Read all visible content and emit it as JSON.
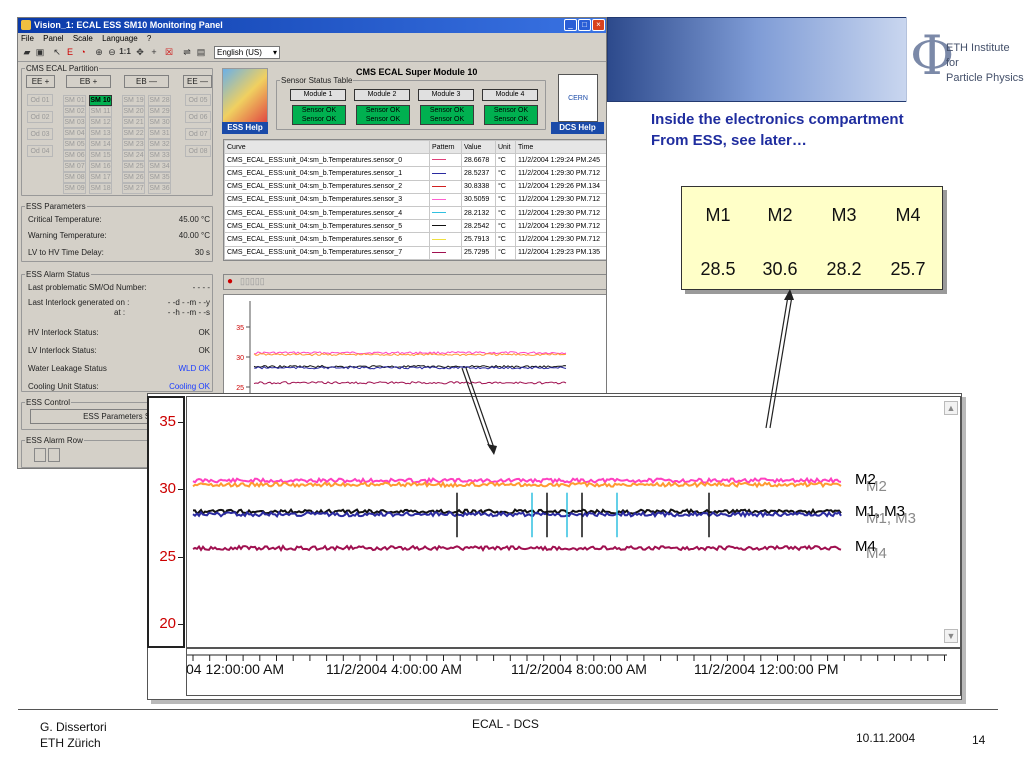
{
  "window": {
    "title": "Vision_1: ECAL ESS SM10 Monitoring Panel",
    "menu": [
      "File",
      "Panel",
      "Scale",
      "Language",
      "?"
    ],
    "language_select": "English (US)"
  },
  "partition": {
    "group_label": "CMS ECAL Partition",
    "buttons": [
      "EE +",
      "EB +",
      "EB —",
      "EE —"
    ],
    "od_left": [
      "Od 01",
      "Od 02",
      "Od 03",
      "Od 04"
    ],
    "od_right": [
      "Od 05",
      "Od 06",
      "Od 07",
      "Od 08"
    ],
    "sm_col1": [
      "SM 01",
      "SM 02",
      "SM 03",
      "SM 04",
      "SM 05",
      "SM 06",
      "SM 07",
      "SM 08",
      "SM 09"
    ],
    "sm_col2": [
      "SM 10",
      "SM 11",
      "SM 12",
      "SM 13",
      "SM 14",
      "SM 15",
      "SM 16",
      "SM 17",
      "SM 18"
    ],
    "sm_col3": [
      "SM 19",
      "SM 20",
      "SM 21",
      "SM 22",
      "SM 23",
      "SM 24",
      "SM 25",
      "SM 26",
      "SM 27"
    ],
    "sm_col4": [
      "SM 28",
      "SM 29",
      "SM 30",
      "SM 31",
      "SM 32",
      "SM 33",
      "SM 34",
      "SM 35",
      "SM 36"
    ],
    "active_color": "#00b050"
  },
  "ess_params": {
    "group_label": "ESS Parameters",
    "rows": [
      {
        "label": "Critical Temperature:",
        "value": "45.00 °C"
      },
      {
        "label": "Warning Temperature:",
        "value": "40.00 °C"
      },
      {
        "label": "LV to HV Time Delay:",
        "value": "30 s"
      }
    ]
  },
  "alarm_status": {
    "group_label": "ESS Alarm Status",
    "last_sm_label": "Last problematic SM/Od Number:",
    "last_sm_value": "- - - -",
    "interlock_label": "Last Interlock generated on :",
    "interlock_date": "- -d - -m - -y",
    "at_label": "at :",
    "interlock_time": "- -h - -m - -s",
    "rows": [
      {
        "label": "HV Interlock Status:",
        "value": "OK",
        "color": "#222222"
      },
      {
        "label": "LV Interlock Status:",
        "value": "OK",
        "color": "#222222"
      },
      {
        "label": "Water Leakage Status",
        "value": "WLD OK",
        "color": "#1a3cff"
      },
      {
        "label": "Cooling Unit Status:",
        "value": "Cooling OK",
        "color": "#1a3cff"
      }
    ]
  },
  "ess_control": {
    "group_label": "ESS Control",
    "button": "ESS Parameters Set"
  },
  "alarm_row": {
    "group_label": "ESS Alarm Row"
  },
  "supermodule": {
    "title": "CMS ECAL Super Module 10",
    "sensor_table_label": "Sensor Status Table",
    "modules": [
      {
        "name": "Module 1",
        "s1": "Sensor OK",
        "s2": "Sensor OK"
      },
      {
        "name": "Module 2",
        "s1": "Sensor OK",
        "s2": "Sensor OK"
      },
      {
        "name": "Module 3",
        "s1": "Sensor OK",
        "s2": "Sensor OK"
      },
      {
        "name": "Module 4",
        "s1": "Sensor OK",
        "s2": "Sensor OK"
      }
    ],
    "ess_help": "ESS Help",
    "dcs_help": "DCS Help",
    "cern_label": "CERN"
  },
  "curve_table": {
    "headers": [
      "Curve",
      "Pattern",
      "Value",
      "Unit",
      "Time"
    ],
    "rows": [
      {
        "curve": "CMS_ECAL_ESS:unit_04:sm_b.Temperatures.sensor_0",
        "color": "#e0407a",
        "value": "28.6678",
        "unit": "°C",
        "time": "11/2/2004 1:29:24 PM.245"
      },
      {
        "curve": "CMS_ECAL_ESS:unit_04:sm_b.Temperatures.sensor_1",
        "color": "#2a2aa0",
        "value": "28.5237",
        "unit": "°C",
        "time": "11/2/2004 1:29:30 PM.712"
      },
      {
        "curve": "CMS_ECAL_ESS:unit_04:sm_b.Temperatures.sensor_2",
        "color": "#d02020",
        "value": "30.8338",
        "unit": "°C",
        "time": "11/2/2004 1:29:26 PM.134"
      },
      {
        "curve": "CMS_ECAL_ESS:unit_04:sm_b.Temperatures.sensor_3",
        "color": "#ff60d0",
        "value": "30.5059",
        "unit": "°C",
        "time": "11/2/2004 1:29:30 PM.712"
      },
      {
        "curve": "CMS_ECAL_ESS:unit_04:sm_b.Temperatures.sensor_4",
        "color": "#30c0e0",
        "value": "28.2132",
        "unit": "°C",
        "time": "11/2/2004 1:29:30 PM.712"
      },
      {
        "curve": "CMS_ECAL_ESS:unit_04:sm_b.Temperatures.sensor_5",
        "color": "#111111",
        "value": "28.2542",
        "unit": "°C",
        "time": "11/2/2004 1:29:30 PM.712"
      },
      {
        "curve": "CMS_ECAL_ESS:unit_04:sm_b.Temperatures.sensor_6",
        "color": "#f0e040",
        "value": "25.7913",
        "unit": "°C",
        "time": "11/2/2004 1:29:30 PM.712"
      },
      {
        "curve": "CMS_ECAL_ESS:unit_04:sm_b.Temperatures.sensor_7",
        "color": "#a01050",
        "value": "25.7295",
        "unit": "°C",
        "time": "11/2/2004 1:29:23 PM.135"
      }
    ]
  },
  "small_chart": {
    "y_ticks": [
      "35",
      "30",
      "25",
      "20"
    ]
  },
  "chart_data": {
    "type": "line",
    "y_ticks": [
      "35",
      "30",
      "25",
      "20"
    ],
    "ylim": [
      18,
      36
    ],
    "x_ticks": [
      "04 12:00:00 AM",
      "11/2/2004 4:00:00 AM",
      "11/2/2004 8:00:00 AM",
      "11/2/2004 12:00:00 PM"
    ],
    "series": [
      {
        "name": "M2",
        "color": "#ff40c0",
        "level": 30.7
      },
      {
        "name": "M2",
        "color": "#ff9a30",
        "level": 30.4
      },
      {
        "name": "M1, M3",
        "color": "#111111",
        "level": 28.4
      },
      {
        "name": "M1, M3",
        "color": "#2a2aa0",
        "level": 28.2
      },
      {
        "name": "M4",
        "color": "#a01050",
        "level": 25.7
      }
    ],
    "labels": [
      {
        "text": "M2",
        "level": 30.7
      },
      {
        "text": "M1, M3",
        "level": 28.3
      },
      {
        "text": "M4",
        "level": 25.7
      }
    ]
  },
  "note": {
    "line1": "Inside the electronics compartment",
    "line2": "From ESS, see later…"
  },
  "module_box": {
    "headers": [
      "M1",
      "M2",
      "M3",
      "M4"
    ],
    "values": [
      "28.5",
      "30.6",
      "28.2",
      "25.7"
    ]
  },
  "logo": {
    "line1": "ETH Institute for",
    "line2": "Particle Physics"
  },
  "footer": {
    "author": "G. Dissertori",
    "institution": "ETH Zürich",
    "center": "ECAL - DCS",
    "date": "10.11.2004",
    "page": "14"
  }
}
